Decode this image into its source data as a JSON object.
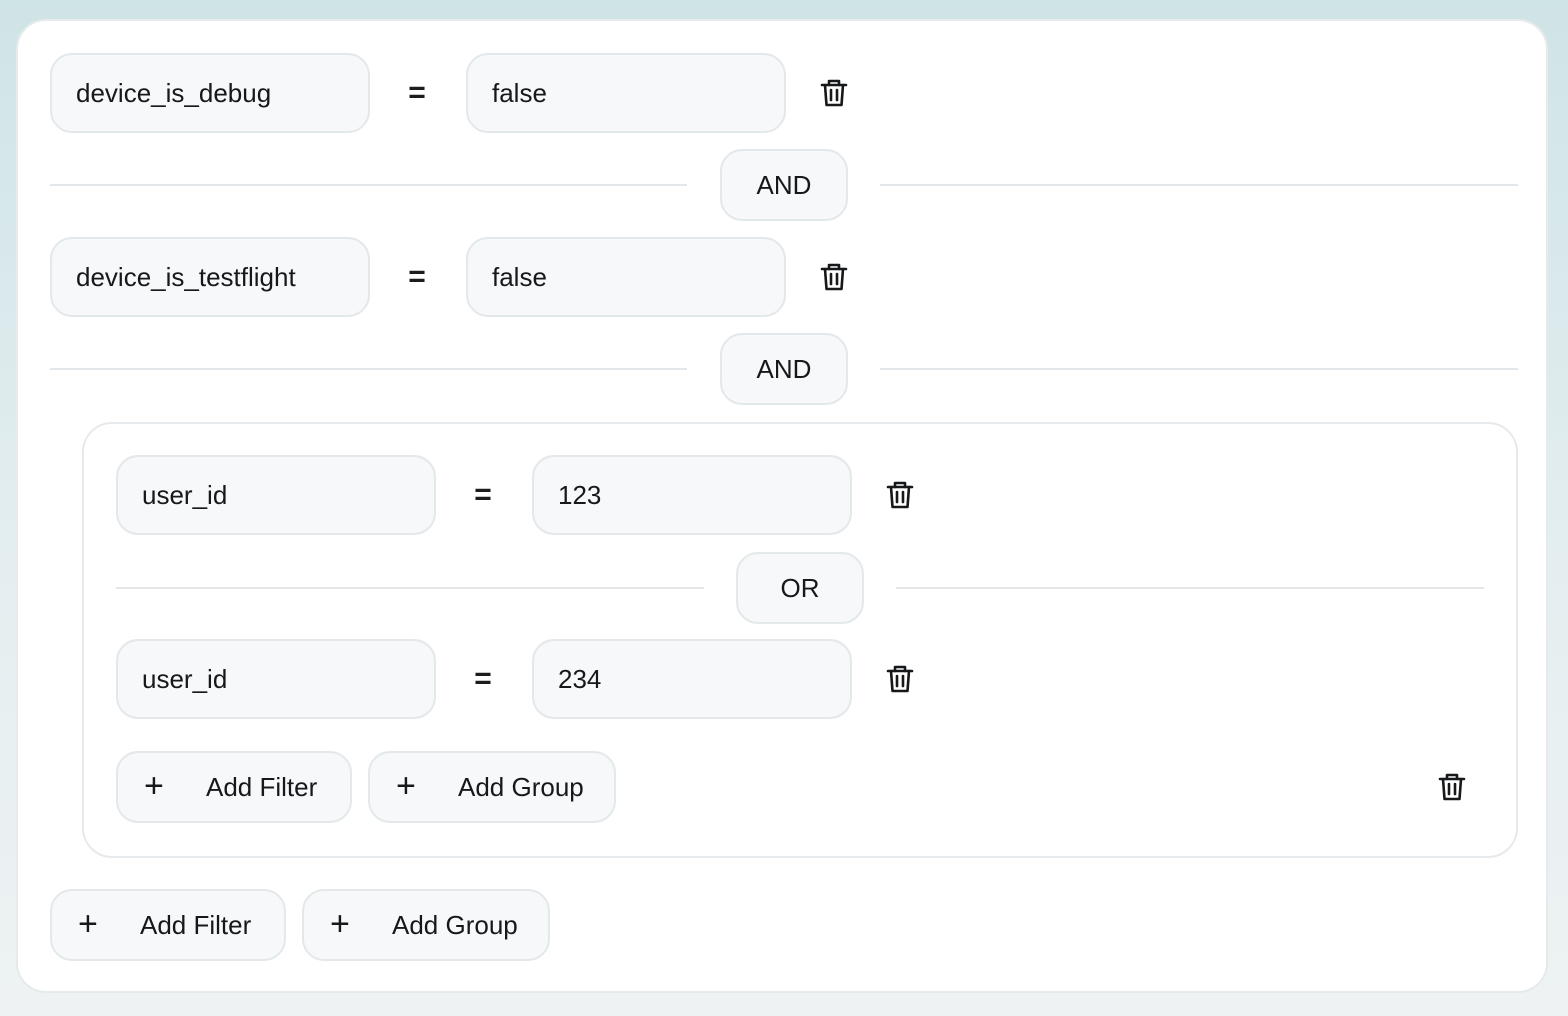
{
  "root": {
    "filters": [
      {
        "field": "device_is_debug",
        "operator": "=",
        "value": "false"
      },
      {
        "field": "device_is_testflight",
        "operator": "=",
        "value": "false"
      }
    ],
    "connectors": [
      "AND",
      "AND"
    ],
    "group": {
      "filters": [
        {
          "field": "user_id",
          "operator": "=",
          "value": "123"
        },
        {
          "field": "user_id",
          "operator": "=",
          "value": "234"
        }
      ],
      "connector": "OR",
      "add_filter_label": "Add Filter",
      "add_group_label": "Add Group"
    },
    "add_filter_label": "Add Filter",
    "add_group_label": "Add Group"
  },
  "icons": {
    "plus": "+",
    "delete": "trash-icon"
  }
}
